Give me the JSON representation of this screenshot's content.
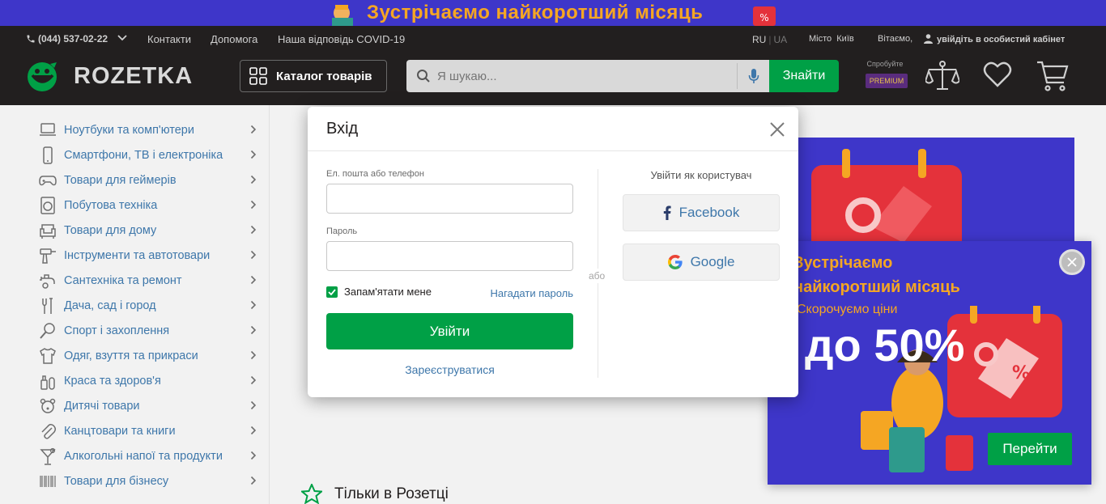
{
  "promo": {
    "headline": "Зустрічаємо найкоротший місяць"
  },
  "topbar": {
    "phone": "(044) 537-02-22",
    "links": [
      "Контакти",
      "Допомога",
      "Наша відповідь COVID-19"
    ],
    "lang_ru": "RU",
    "lang_sep": "|",
    "lang_ua": "UA",
    "city_label": "Місто",
    "city_value": "Київ",
    "greeting": "Вітаємо,",
    "cabinet": "увійдіть в особистий кабінет"
  },
  "header": {
    "logo_text": "ROZETKA",
    "catalog_label": "Каталог товарів",
    "search_placeholder": "Я шукаю...",
    "search_button": "Знайти",
    "premium_try": "Спробуйте",
    "premium_badge": "PREMIUM"
  },
  "sidebar": {
    "items": [
      {
        "label": "Ноутбуки та комп'ютери",
        "icon": "laptop-icon"
      },
      {
        "label": "Смартфони, ТВ і електроніка",
        "icon": "smartphone-icon"
      },
      {
        "label": "Товари для геймерів",
        "icon": "gamepad-icon"
      },
      {
        "label": "Побутова техніка",
        "icon": "washer-icon"
      },
      {
        "label": "Товари для дому",
        "icon": "armchair-icon"
      },
      {
        "label": "Інструменти та автотовари",
        "icon": "drill-icon"
      },
      {
        "label": "Сантехніка та ремонт",
        "icon": "faucet-icon"
      },
      {
        "label": "Дача, сад і город",
        "icon": "garden-fork-icon"
      },
      {
        "label": "Спорт і захоплення",
        "icon": "racket-icon"
      },
      {
        "label": "Одяг, взуття та прикраси",
        "icon": "tshirt-icon"
      },
      {
        "label": "Краса та здоров'я",
        "icon": "cosmetics-icon"
      },
      {
        "label": "Дитячі товари",
        "icon": "teddy-icon"
      },
      {
        "label": "Канцтовари та книги",
        "icon": "paperclip-icon"
      },
      {
        "label": "Алкогольні напої та продукти",
        "icon": "cocktail-icon"
      },
      {
        "label": "Товари для бізнесу",
        "icon": "barcode-icon"
      }
    ]
  },
  "main": {
    "section_title": "Тільки в Розетці"
  },
  "modal": {
    "title": "Вхід",
    "email_label": "Ел. пошта або телефон",
    "email_value": "",
    "password_label": "Пароль",
    "password_value": "",
    "remember_label": "Запам'ятати мене",
    "remember_checked": true,
    "forgot_link": "Нагадати пароль",
    "login_button": "Увійти",
    "register_link": "Зареєструватися",
    "or_text": "або",
    "social_heading": "Увійти як користувач",
    "facebook_label": "Facebook",
    "google_label": "Google"
  },
  "popup": {
    "line1": "Зустрічаємо",
    "line2": "найкоротший місяць",
    "line3": "Скорочуємо ціни",
    "big": "до 50%",
    "button": "Перейти"
  },
  "colors": {
    "brand_green": "#00a046",
    "header_dark": "#221f1f",
    "link_blue": "#3e77aa",
    "promo_purple": "#3e36c9",
    "promo_orange": "#f5a623"
  }
}
